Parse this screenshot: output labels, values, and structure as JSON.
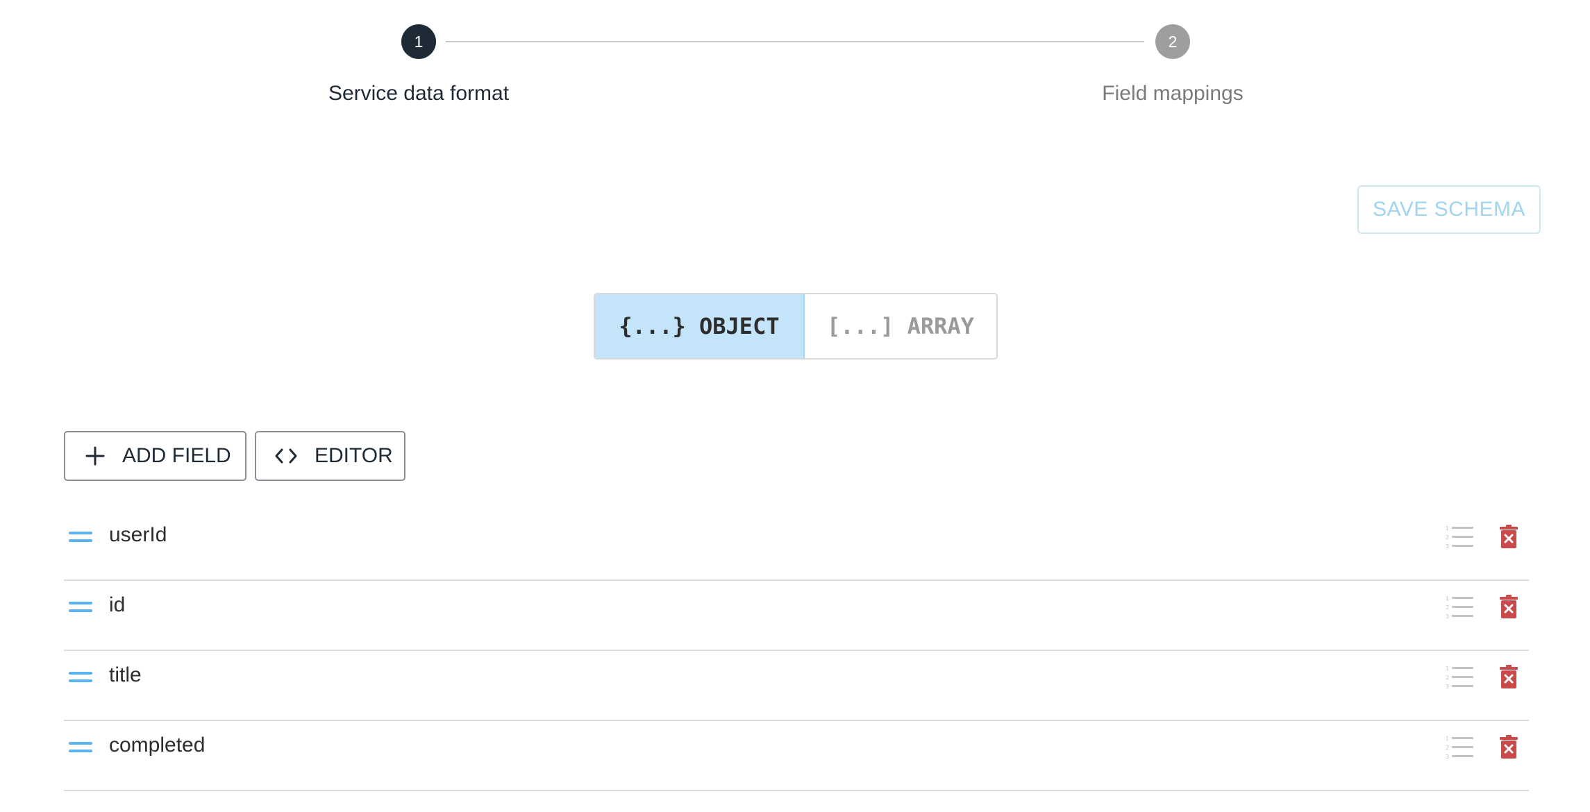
{
  "stepper": {
    "steps": [
      {
        "number": "1",
        "label": "Service data format"
      },
      {
        "number": "2",
        "label": "Field mappings"
      }
    ]
  },
  "save_schema_label": "SAVE SCHEMA",
  "type_toggle": {
    "object_label": "{...} OBJECT",
    "array_label": "[...] ARRAY",
    "selected": "object"
  },
  "actions": {
    "add_field_label": "ADD FIELD",
    "editor_label": "EDITOR"
  },
  "fields": [
    {
      "name": "userId"
    },
    {
      "name": "id"
    },
    {
      "name": "title"
    },
    {
      "name": "completed"
    }
  ],
  "colors": {
    "step_active": "#1f2a37",
    "step_inactive": "#9e9e9e",
    "toggle_selected_bg": "#c4e4f9",
    "drag_handle": "#5ab3ee",
    "delete_icon": "#c94a4a"
  }
}
